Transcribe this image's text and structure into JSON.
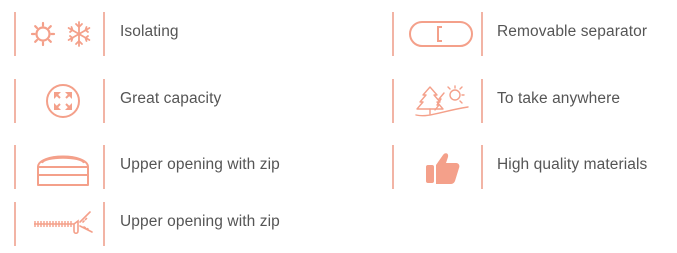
{
  "colors": {
    "accent": "#f4a08a",
    "divider": "#f2b4a5",
    "text": "#555555"
  },
  "features": [
    {
      "icon": [
        "sun-icon",
        "snowflake-icon"
      ],
      "label": "Isolating"
    },
    {
      "icon": [
        "expand-arrows-icon"
      ],
      "label": "Great capacity"
    },
    {
      "icon": [
        "bag-top-icon"
      ],
      "label": "Upper opening with zip"
    },
    {
      "icon": [
        "zipper-icon"
      ],
      "label": "Upper opening with zip"
    },
    {
      "icon": [
        "separator-icon"
      ],
      "label": "Removable separator"
    },
    {
      "icon": [
        "trees-sun-icon"
      ],
      "label": "To take anywhere"
    },
    {
      "icon": [
        "thumbs-up-icon"
      ],
      "label": "High quality materials"
    }
  ]
}
